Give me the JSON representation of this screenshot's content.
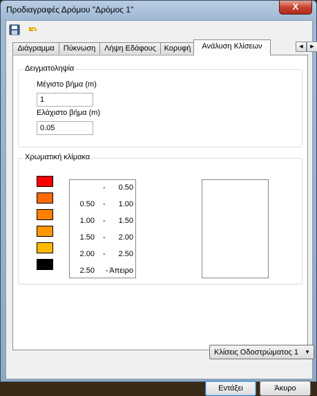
{
  "window": {
    "title": "Προδιαγραφές Δρόμου \"Δρόμος 1\"",
    "close_glyph": "X"
  },
  "toolbar": {
    "icons": [
      "save-icon",
      "undo-icon"
    ]
  },
  "tabs": [
    {
      "label": "Διάγραμμα",
      "active": false
    },
    {
      "label": "Πύκνωση",
      "active": false
    },
    {
      "label": "Λήψη Εδάφους",
      "active": false
    },
    {
      "label": "Κορυφή",
      "active": false
    },
    {
      "label": "Ανάλυση Κλίσεων",
      "active": true
    }
  ],
  "sampling": {
    "title": "Δειγματοληψία",
    "max_step_label": "Μέγιστο βήμα (m)",
    "max_step_value": "1",
    "min_step_label": "Ελάχιστο βήμα (m)",
    "min_step_value": "0.05"
  },
  "color_scale": {
    "title": "Χρωματική κλίμακα",
    "ranges": [
      {
        "from": "",
        "dash": "-",
        "to": "0.50",
        "color": "#ff0000"
      },
      {
        "from": "0.50",
        "dash": "-",
        "to": "1.00",
        "color": "#ff6a00"
      },
      {
        "from": "1.00",
        "dash": "-",
        "to": "1.50",
        "color": "#ff8000"
      },
      {
        "from": "1.50",
        "dash": "-",
        "to": "2.00",
        "color": "#ff9900"
      },
      {
        "from": "2.00",
        "dash": "-",
        "to": "2.50",
        "color": "#ffbb00"
      },
      {
        "from": "2.50",
        "dash": "-",
        "to": "Άπειρο",
        "color": "#000000"
      }
    ]
  },
  "layer_select": {
    "value": "Κλίσεις Οδοστρώματος 1"
  },
  "buttons": {
    "ok": "Εντάξει",
    "cancel": "Άκυρο"
  }
}
